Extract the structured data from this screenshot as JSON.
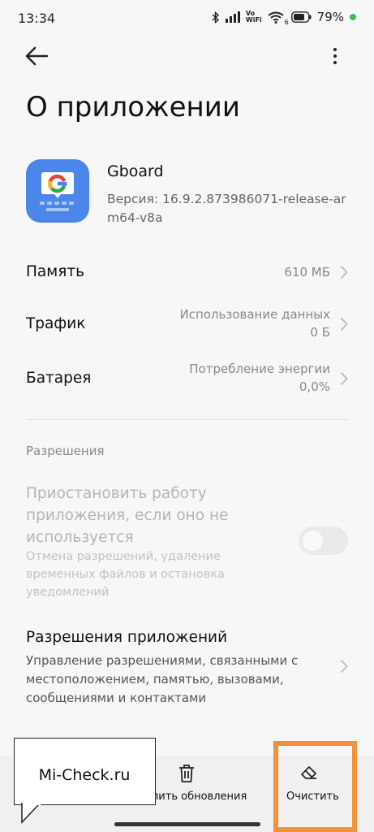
{
  "status_bar": {
    "time": "13:34",
    "network_label_top": "Vo",
    "network_label_bottom": "WiFi",
    "wifi_sub": "6",
    "battery": "79%",
    "battery_dot_color": "#3bbf4a"
  },
  "header": {
    "back_icon": "arrow-left-icon",
    "more_icon": "more-vertical-icon",
    "title": "О приложении"
  },
  "app": {
    "icon": "gboard-icon",
    "name": "Gboard",
    "version": "Версия: 16.9.2.873986071-release-arm64-v8a"
  },
  "info_rows": [
    {
      "label": "Память",
      "value_line1": "",
      "value_line2": "610 МБ"
    },
    {
      "label": "Трафик",
      "value_line1": "Использование данных",
      "value_line2": "0 Б"
    },
    {
      "label": "Батарея",
      "value_line1": "Потребление энергии",
      "value_line2": "0,0%"
    }
  ],
  "permissions": {
    "section_title": "Разрешения",
    "pause_title": "Приостановить работу приложения, если оно не используется",
    "pause_desc": "Отмена разрешений, удаление временных файлов и остановка уведомлений",
    "pause_enabled": false,
    "app_perms_title": "Разрешения приложений",
    "app_perms_desc": "Управление разрешениями, связанными с местоположением, памятью, вызовами, сообщениями и контактами"
  },
  "bottom_bar": {
    "uninstall_updates_label": "лить обновления",
    "clear_label": "Очистить",
    "trash_icon": "trash-icon",
    "eraser_icon": "eraser-icon"
  },
  "watermark": {
    "text": "Mi-Check.ru"
  },
  "colors": {
    "accent_highlight": "#f0913b",
    "app_icon_bg": "#4b86ea"
  }
}
